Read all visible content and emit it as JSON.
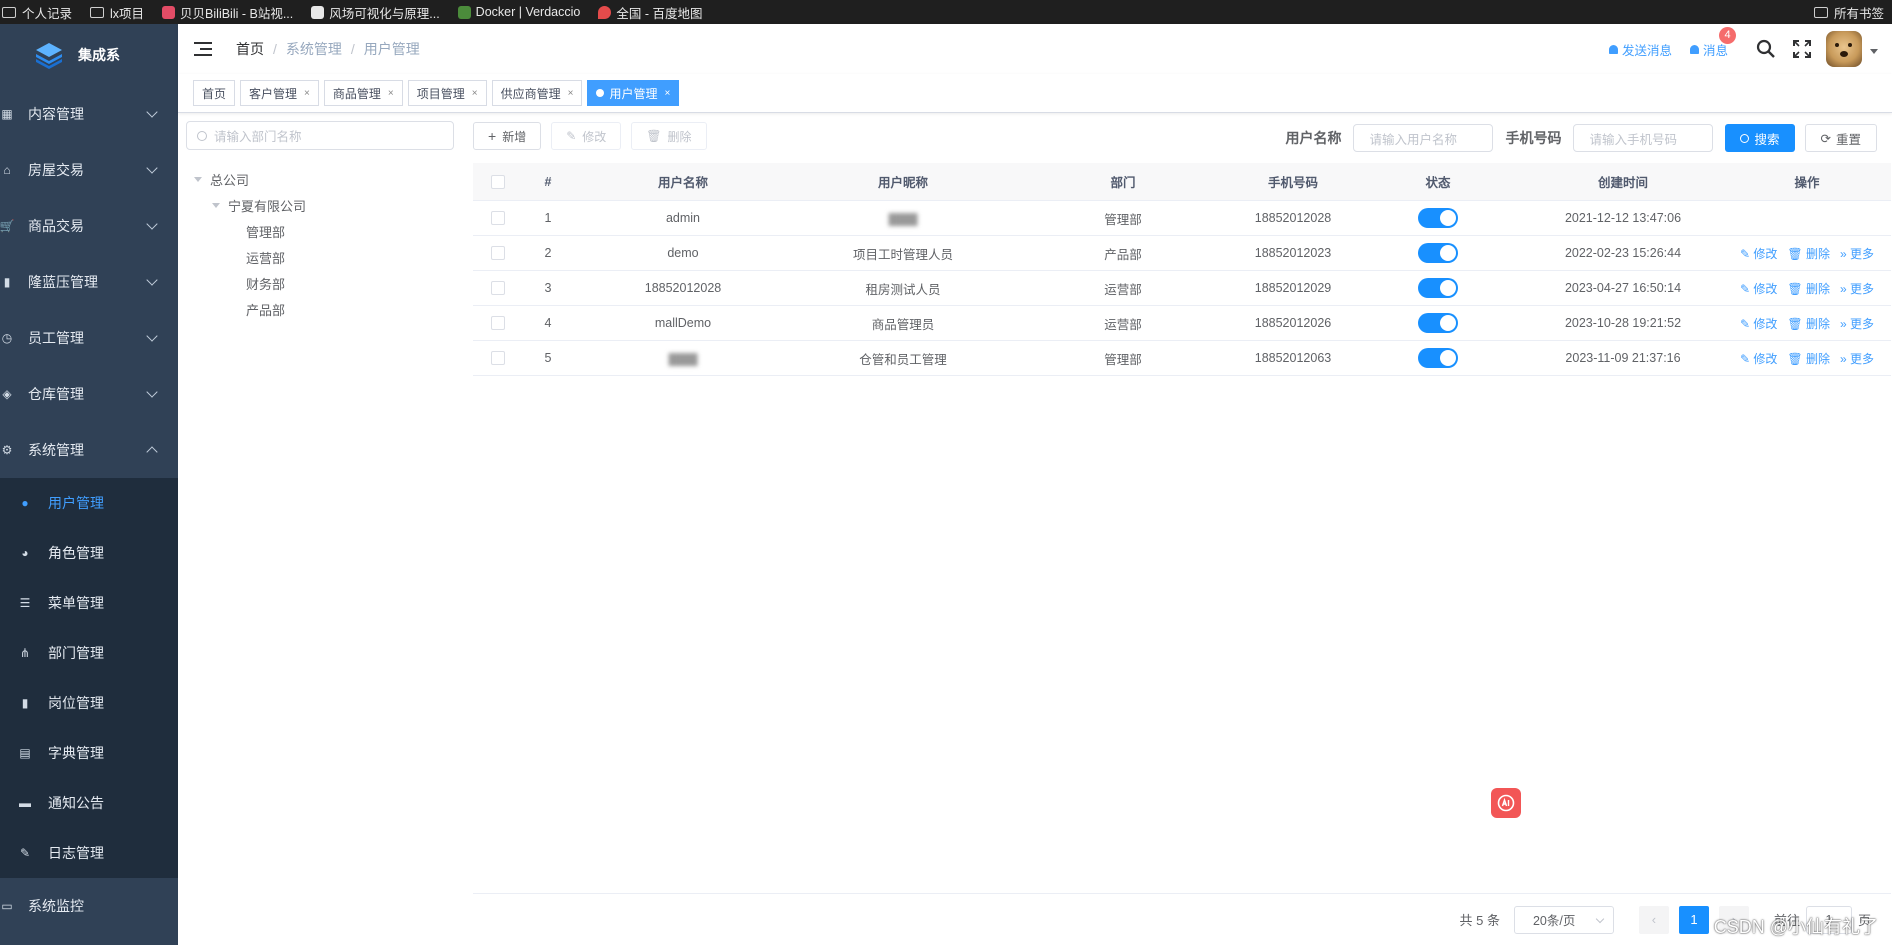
{
  "bookmarks": {
    "items": [
      {
        "label": "个人记录",
        "icon": "folder-icon"
      },
      {
        "label": "lx项目",
        "icon": "folder-icon"
      },
      {
        "label": "贝贝BiliBili - B站视...",
        "icon": "bilibili-icon"
      },
      {
        "label": "风场可视化与原理...",
        "icon": "site-icon"
      },
      {
        "label": "Docker | Verdaccio",
        "icon": "verdaccio-icon"
      },
      {
        "label": "全国 - 百度地图",
        "icon": "map-pin-icon"
      }
    ],
    "all_bookmarks": "所有书签"
  },
  "sidebar": {
    "logo_title": "集成系",
    "menus": [
      {
        "label": "内容管理",
        "icon": "grid-icon"
      },
      {
        "label": "房屋交易",
        "icon": "home-icon"
      },
      {
        "label": "商品交易",
        "icon": "cart-icon"
      },
      {
        "label": "隆蓝压管理",
        "icon": "doc-icon"
      },
      {
        "label": "员工管理",
        "icon": "clock-icon"
      },
      {
        "label": "仓库管理",
        "icon": "layers-icon"
      },
      {
        "label": "系统管理",
        "icon": "gear-icon"
      }
    ],
    "submenus": [
      {
        "label": "用户管理",
        "icon": "user-icon"
      },
      {
        "label": "角色管理",
        "icon": "users-icon"
      },
      {
        "label": "菜单管理",
        "icon": "list-icon"
      },
      {
        "label": "部门管理",
        "icon": "tree-icon"
      },
      {
        "label": "岗位管理",
        "icon": "post-icon"
      },
      {
        "label": "字典管理",
        "icon": "book-icon"
      },
      {
        "label": "通知公告",
        "icon": "message-icon"
      }
    ],
    "bottom_menus": [
      {
        "label": "日志管理",
        "icon": "edit-icon"
      },
      {
        "label": "系统监控",
        "icon": "monitor-icon"
      }
    ]
  },
  "header": {
    "breadcrumb": [
      "首页",
      "系统管理",
      "用户管理"
    ],
    "send_message": "发送消息",
    "messages": "消息",
    "messages_badge": "4"
  },
  "tags": [
    {
      "label": "首页",
      "closable": false
    },
    {
      "label": "客户管理",
      "closable": true
    },
    {
      "label": "商品管理",
      "closable": true
    },
    {
      "label": "项目管理",
      "closable": true
    },
    {
      "label": "供应商管理",
      "closable": true
    },
    {
      "label": "用户管理",
      "closable": true,
      "active": true
    }
  ],
  "dept_panel": {
    "search_placeholder": "请输入部门名称",
    "tree": {
      "root": "总公司",
      "child": "宁夏有限公司",
      "leaves": [
        "管理部",
        "运营部",
        "财务部",
        "产品部"
      ]
    }
  },
  "toolbar": {
    "add": "新增",
    "edit": "修改",
    "delete": "删除"
  },
  "search": {
    "username_label": "用户名称",
    "username_placeholder": "请输入用户名称",
    "phone_label": "手机号码",
    "phone_placeholder": "请输入手机号码",
    "search_btn": "搜索",
    "reset_btn": "重置"
  },
  "table": {
    "columns": [
      "#",
      "用户名称",
      "用户昵称",
      "部门",
      "手机号码",
      "状态",
      "创建时间",
      "操作"
    ],
    "rows": [
      {
        "idx": "1",
        "username": "admin",
        "nickname": "",
        "dept": "管理部",
        "phone": "18852012028",
        "status": true,
        "created": "2021-12-12 13:47:06",
        "ops": false
      },
      {
        "idx": "2",
        "username": "demo",
        "nickname": "项目工时管理人员",
        "dept": "产品部",
        "phone": "18852012023",
        "status": true,
        "created": "2022-02-23 15:26:44",
        "ops": true
      },
      {
        "idx": "3",
        "username": "18852012028",
        "nickname": "租房测试人员",
        "dept": "运营部",
        "phone": "18852012029",
        "status": true,
        "created": "2023-04-27 16:50:14",
        "ops": true
      },
      {
        "idx": "4",
        "username": "mallDemo",
        "nickname": "商品管理员",
        "dept": "运营部",
        "phone": "18852012026",
        "status": true,
        "created": "2023-10-28 19:21:52",
        "ops": true
      },
      {
        "idx": "5",
        "username": "",
        "nickname": "仓管和员工管理",
        "dept": "管理部",
        "phone": "18852012063",
        "status": true,
        "created": "2023-11-09 21:37:16",
        "ops": true
      }
    ],
    "op_labels": {
      "edit": "修改",
      "delete": "删除",
      "more": "更多"
    }
  },
  "pagination": {
    "total": "共 5 条",
    "page_size": "20条/页",
    "current": "1",
    "goto_prefix": "前往",
    "goto_value": "1",
    "goto_suffix": "页"
  },
  "watermark": "CSDN @小仙有礼了",
  "colors": {
    "primary": "#1890ff",
    "sidebar_bg": "#304156",
    "sidebar_sub_bg": "#1f2d3d",
    "active_text": "#409eff"
  }
}
